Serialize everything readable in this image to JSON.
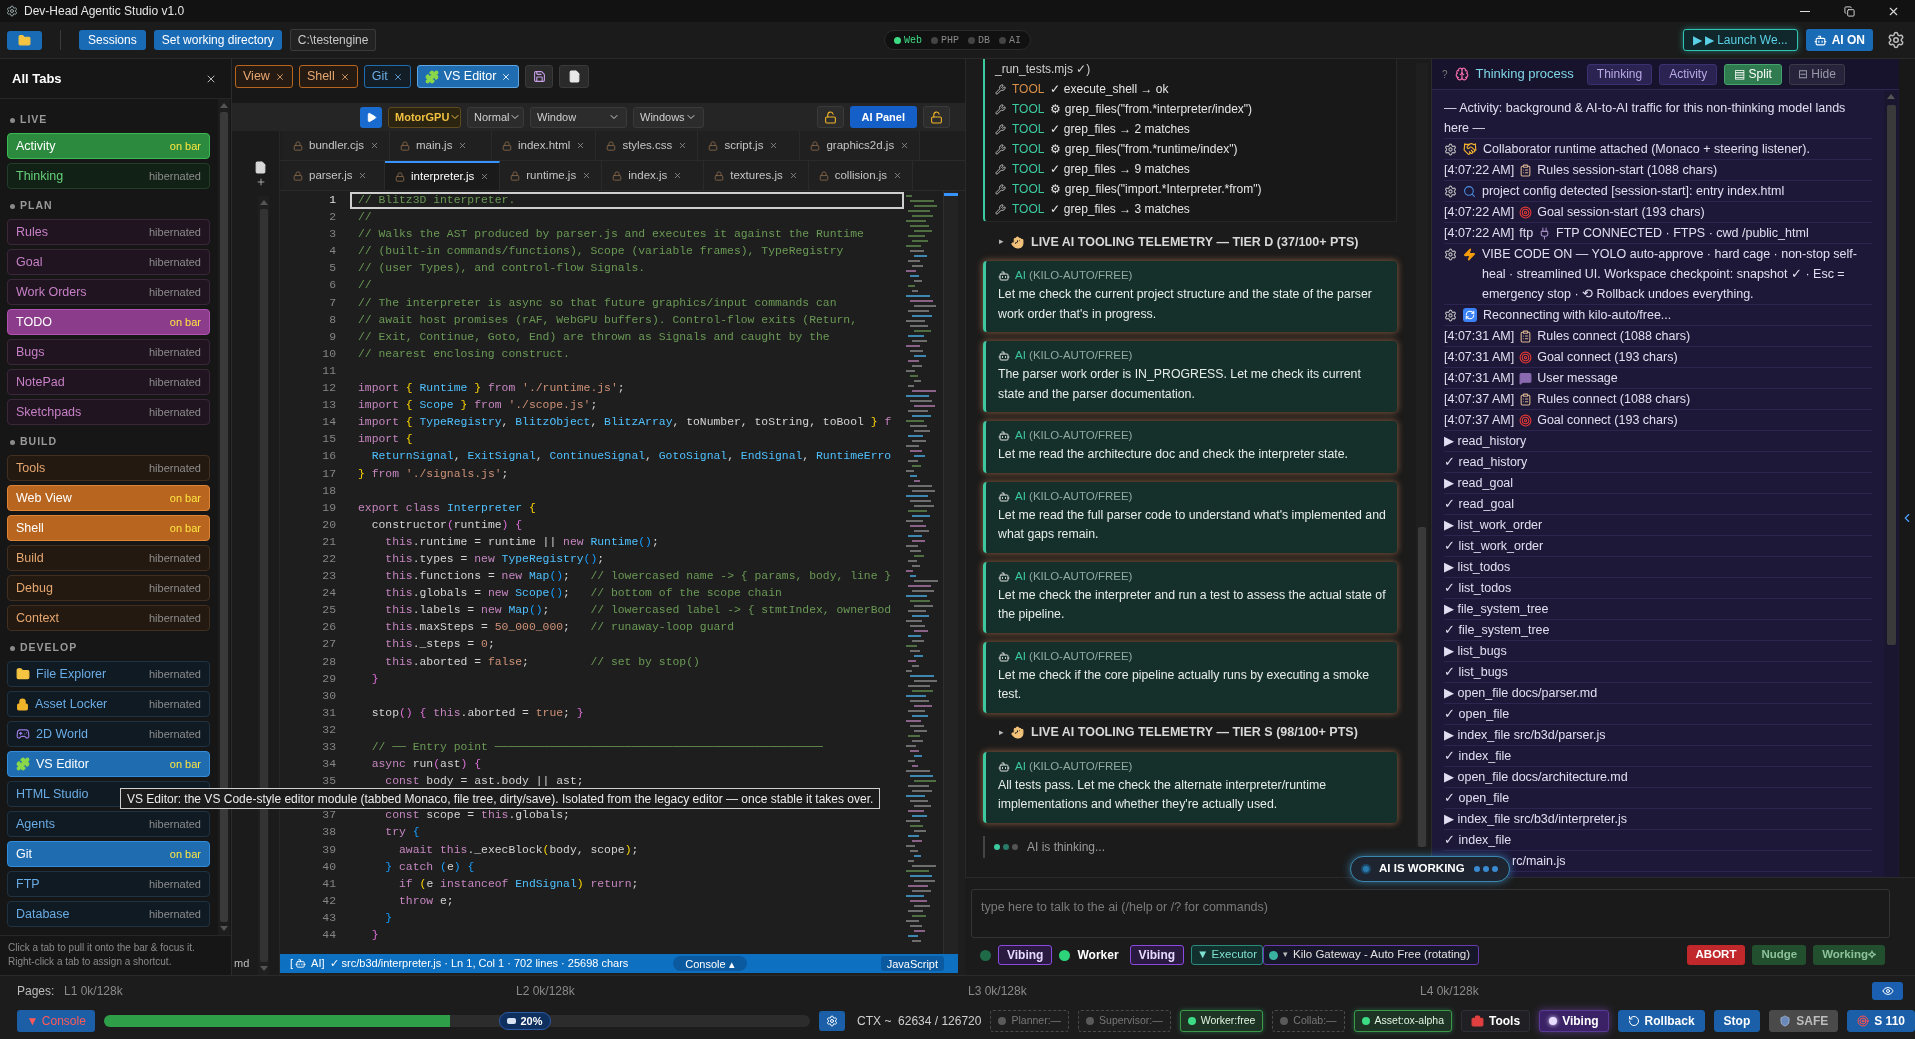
{
  "window": {
    "title": "Dev-Head Agentic Studio v1.0"
  },
  "toolbar": {
    "sessions": "Sessions",
    "set_directory": "Set working directory",
    "directory": "C:\\testengine",
    "services": [
      {
        "label": "Web",
        "on": true
      },
      {
        "label": "PHP",
        "on": false
      },
      {
        "label": "DB",
        "on": false
      },
      {
        "label": "AI",
        "on": false
      }
    ],
    "launch": "▶ ▶ Launch We...",
    "ai_toggle": "AI ON"
  },
  "all_tabs": {
    "title": "All Tabs",
    "groups": [
      {
        "name": "LIVE",
        "color": "#2b8a3e",
        "items": [
          {
            "label": "Activity",
            "status": "on bar",
            "on_bar": true,
            "kind": "plain"
          },
          {
            "label": "Thinking",
            "status": "hibernated",
            "on_bar": false,
            "kind": "plain"
          }
        ]
      },
      {
        "name": "PLAN",
        "color": "#8b3d8b",
        "items": [
          {
            "label": "Rules",
            "status": "hibernated",
            "on_bar": false,
            "kind": "plain"
          },
          {
            "label": "Goal",
            "status": "hibernated",
            "on_bar": false,
            "kind": "plain"
          },
          {
            "label": "Work Orders",
            "status": "hibernated",
            "on_bar": false,
            "kind": "plain"
          },
          {
            "label": "TODO",
            "status": "on bar",
            "on_bar": true,
            "kind": "plain"
          },
          {
            "label": "Bugs",
            "status": "hibernated",
            "on_bar": false,
            "kind": "plain"
          },
          {
            "label": "NotePad",
            "status": "hibernated",
            "on_bar": false,
            "kind": "plain"
          },
          {
            "label": "Sketchpads",
            "status": "hibernated",
            "on_bar": false,
            "kind": "plain"
          }
        ]
      },
      {
        "name": "BUILD",
        "color": "#b8661f",
        "items": [
          {
            "label": "Tools",
            "status": "hibernated",
            "on_bar": false,
            "kind": "plain"
          },
          {
            "label": "Web View",
            "status": "on bar",
            "on_bar": true,
            "kind": "plain"
          },
          {
            "label": "Shell",
            "status": "on bar",
            "on_bar": true,
            "kind": "plain"
          },
          {
            "label": "Build",
            "status": "hibernated",
            "on_bar": false,
            "kind": "plain"
          },
          {
            "label": "Debug",
            "status": "hibernated",
            "on_bar": false,
            "kind": "plain"
          },
          {
            "label": "Context",
            "status": "hibernated",
            "on_bar": false,
            "kind": "plain"
          }
        ]
      },
      {
        "name": "DEVELOP",
        "color": "#1f6db0",
        "items": [
          {
            "label": "File Explorer",
            "status": "hibernated",
            "on_bar": false,
            "kind": "explorer"
          },
          {
            "label": "Asset Locker",
            "status": "hibernated",
            "on_bar": false,
            "kind": "locker"
          },
          {
            "label": "2D World",
            "status": "hibernated",
            "on_bar": false,
            "kind": "world"
          },
          {
            "label": "VS Editor",
            "status": "on bar",
            "on_bar": true,
            "kind": "editor"
          },
          {
            "label": "HTML Studio",
            "on_bar": false,
            "kind": "plain"
          },
          {
            "label": "Agents",
            "status": "hibernated",
            "on_bar": false,
            "kind": "plain"
          },
          {
            "label": "Git",
            "status": "on bar",
            "on_bar": true,
            "kind": "plain"
          },
          {
            "label": "FTP",
            "status": "hibernated",
            "on_bar": false,
            "kind": "plain"
          },
          {
            "label": "Database",
            "status": "hibernated",
            "on_bar": false,
            "kind": "plain"
          }
        ]
      }
    ],
    "hint": [
      "Click a tab to pull it onto the bar & focus it.",
      "Right-click a tab to assign a shortcut."
    ]
  },
  "tooltip": "VS Editor: the VS Code-style editor module (tabbed Monaco, file tree, dirty/save). Isolated from the legacy editor — once stable it takes over.",
  "open_tabs": [
    {
      "label": "View",
      "color": "#b8661f",
      "selected": false,
      "kind": "plain"
    },
    {
      "label": "Shell",
      "color": "#b8661f",
      "selected": false,
      "kind": "plain"
    },
    {
      "label": "Git",
      "color": "#1f6db0",
      "selected": false,
      "kind": "plain"
    },
    {
      "label": "VS Editor",
      "color": "#1f6db0",
      "selected": true,
      "kind": "editor"
    }
  ],
  "editor": {
    "toolbar": {
      "target": "MotorGPU",
      "mode": "Normal",
      "display": "Window",
      "platform": "Windows",
      "ai_panel": "AI Panel"
    },
    "file_tabs": [
      [
        {
          "name": "bundler.cjs",
          "selected": false
        },
        {
          "name": "main.js",
          "selected": false
        },
        {
          "name": "index.html",
          "selected": false
        },
        {
          "name": "styles.css",
          "selected": false
        },
        {
          "name": "script.js",
          "selected": false
        },
        {
          "name": "graphics2d.js",
          "selected": false
        }
      ],
      [
        {
          "name": "parser.js",
          "selected": false
        },
        {
          "name": "interpreter.js",
          "selected": true
        },
        {
          "name": "runtime.js",
          "selected": false
        },
        {
          "name": "index.js",
          "selected": false
        },
        {
          "name": "textures.js",
          "selected": false
        },
        {
          "name": "collision.js",
          "selected": false
        }
      ]
    ],
    "explorer_tail": "md",
    "lines": [
      {
        "n": "1",
        "current": true,
        "code": [
          {
            "kind": "comment",
            "text": "// Blitz3D interpreter."
          }
        ]
      },
      {
        "n": "2",
        "code": [
          {
            "kind": "comment",
            "text": "//"
          }
        ]
      },
      {
        "n": "3",
        "code": [
          {
            "kind": "comment",
            "text": "// Walks the AST produced by parser.js and executes it against the Runtime"
          }
        ]
      },
      {
        "n": "4",
        "code": [
          {
            "kind": "comment",
            "text": "// (built-in commands/functions), Scope (variable frames), TypeRegistry"
          }
        ]
      },
      {
        "n": "5",
        "code": [
          {
            "kind": "comment",
            "text": "// (user Types), and control-flow Signals."
          }
        ]
      },
      {
        "n": "6",
        "code": [
          {
            "kind": "comment",
            "text": "//"
          }
        ]
      },
      {
        "n": "7",
        "code": [
          {
            "kind": "comment",
            "text": "// The interpreter is async so that future graphics/input commands can"
          }
        ]
      },
      {
        "n": "8",
        "code": [
          {
            "kind": "comment",
            "text": "// await host promises (rAF, WebGPU buffers). Control-flow exits (Return,"
          }
        ]
      },
      {
        "n": "9",
        "code": [
          {
            "kind": "comment",
            "text": "// Exit, Continue, Goto, End) are thrown as Signals and caught by the"
          }
        ]
      },
      {
        "n": "10",
        "code": [
          {
            "kind": "comment",
            "text": "// nearest enclosing construct."
          }
        ]
      },
      {
        "n": "11"
      },
      {
        "n": "12",
        "code": [
          {
            "kind": "keyword",
            "text": "import"
          },
          {
            "kind": "brace",
            "text": " { "
          },
          {
            "kind": "type",
            "text": "Runtime"
          },
          {
            "kind": "brace",
            "text": " }"
          },
          {
            "kind": "keyword",
            "text": " from "
          },
          {
            "kind": "literal",
            "text": "'./runtime.js'"
          },
          {
            "kind": "plain",
            "text": ";"
          }
        ]
      },
      {
        "n": "13",
        "code": [
          {
            "kind": "keyword",
            "text": "import"
          },
          {
            "kind": "brace",
            "text": " { "
          },
          {
            "kind": "type",
            "text": "Scope"
          },
          {
            "kind": "brace",
            "text": " }"
          },
          {
            "kind": "keyword",
            "text": " from "
          },
          {
            "kind": "literal",
            "text": "'./scope.js'"
          },
          {
            "kind": "plain",
            "text": ";"
          }
        ]
      },
      {
        "n": "14",
        "code": [
          {
            "kind": "keyword",
            "text": "import"
          },
          {
            "kind": "brace",
            "text": " { "
          },
          {
            "kind": "type",
            "text": "TypeRegistry"
          },
          {
            "kind": "plain",
            "text": ", "
          },
          {
            "kind": "type",
            "text": "BlitzObject"
          },
          {
            "kind": "plain",
            "text": ", "
          },
          {
            "kind": "type",
            "text": "BlitzArray"
          },
          {
            "kind": "plain",
            "text": ", toNumber, toString, toBool "
          },
          {
            "kind": "brace",
            "text": "}"
          },
          {
            "kind": "keyword",
            "text": " f"
          }
        ]
      },
      {
        "n": "15",
        "code": [
          {
            "kind": "keyword",
            "text": "import"
          },
          {
            "kind": "brace",
            "text": " {"
          }
        ]
      },
      {
        "n": "16",
        "code": [
          {
            "kind": "type",
            "text": "  ReturnSignal"
          },
          {
            "kind": "plain",
            "text": ", "
          },
          {
            "kind": "type",
            "text": "ExitSignal"
          },
          {
            "kind": "plain",
            "text": ", "
          },
          {
            "kind": "type",
            "text": "ContinueSignal"
          },
          {
            "kind": "plain",
            "text": ", "
          },
          {
            "kind": "type",
            "text": "GotoSignal"
          },
          {
            "kind": "plain",
            "text": ", "
          },
          {
            "kind": "type",
            "text": "EndSignal"
          },
          {
            "kind": "plain",
            "text": ", "
          },
          {
            "kind": "type",
            "text": "RuntimeErro"
          }
        ]
      },
      {
        "n": "17",
        "code": [
          {
            "kind": "brace",
            "text": "}"
          },
          {
            "kind": "keyword",
            "text": " from "
          },
          {
            "kind": "literal",
            "text": "'./signals.js'"
          },
          {
            "kind": "plain",
            "text": ";"
          }
        ]
      },
      {
        "n": "18"
      },
      {
        "n": "19",
        "code": [
          {
            "kind": "keyword",
            "text": "export class "
          },
          {
            "kind": "type",
            "text": "Interpreter"
          },
          {
            "kind": "brace",
            "text": " {"
          }
        ]
      },
      {
        "n": "20",
        "code": [
          {
            "kind": "plain",
            "text": "  constructor"
          },
          {
            "kind": "paren",
            "text": "("
          },
          {
            "kind": "plain",
            "text": "runtime"
          },
          {
            "kind": "paren",
            "text": ")"
          },
          {
            "kind": "paren",
            "text": " {"
          }
        ]
      },
      {
        "n": "21",
        "code": [
          {
            "kind": "keyword",
            "text": "    this"
          },
          {
            "kind": "plain",
            "text": ".runtime = runtime || "
          },
          {
            "kind": "keyword",
            "text": "new "
          },
          {
            "kind": "type",
            "text": "Runtime"
          },
          {
            "kind": "call",
            "text": "()"
          },
          {
            "kind": "plain",
            "text": ";"
          }
        ]
      },
      {
        "n": "22",
        "code": [
          {
            "kind": "keyword",
            "text": "    this"
          },
          {
            "kind": "plain",
            "text": ".types = "
          },
          {
            "kind": "keyword",
            "text": "new "
          },
          {
            "kind": "type",
            "text": "TypeRegistry"
          },
          {
            "kind": "call",
            "text": "()"
          },
          {
            "kind": "plain",
            "text": ";"
          }
        ]
      },
      {
        "n": "23",
        "code": [
          {
            "kind": "keyword",
            "text": "    this"
          },
          {
            "kind": "plain",
            "text": ".functions = "
          },
          {
            "kind": "keyword",
            "text": "new "
          },
          {
            "kind": "type",
            "text": "Map"
          },
          {
            "kind": "call",
            "text": "()"
          },
          {
            "kind": "plain",
            "text": ";   "
          },
          {
            "kind": "comment",
            "text": "// lowercased name -> { params, body, line }"
          }
        ]
      },
      {
        "n": "24",
        "code": [
          {
            "kind": "keyword",
            "text": "    this"
          },
          {
            "kind": "plain",
            "text": ".globals = "
          },
          {
            "kind": "keyword",
            "text": "new "
          },
          {
            "kind": "type",
            "text": "Scope"
          },
          {
            "kind": "call",
            "text": "()"
          },
          {
            "kind": "plain",
            "text": ";   "
          },
          {
            "kind": "comment",
            "text": "// bottom of the scope chain"
          }
        ]
      },
      {
        "n": "25",
        "code": [
          {
            "kind": "keyword",
            "text": "    this"
          },
          {
            "kind": "plain",
            "text": ".labels = "
          },
          {
            "kind": "keyword",
            "text": "new "
          },
          {
            "kind": "type",
            "text": "Map"
          },
          {
            "kind": "call",
            "text": "()"
          },
          {
            "kind": "plain",
            "text": ";      "
          },
          {
            "kind": "comment",
            "text": "// lowercased label -> { stmtIndex, ownerBod"
          }
        ]
      },
      {
        "n": "26",
        "code": [
          {
            "kind": "keyword",
            "text": "    this"
          },
          {
            "kind": "plain",
            "text": ".maxSteps = "
          },
          {
            "kind": "literal",
            "text": "50_000_000"
          },
          {
            "kind": "plain",
            "text": ";   "
          },
          {
            "kind": "comment",
            "text": "// runaway-loop guard"
          }
        ]
      },
      {
        "n": "27",
        "code": [
          {
            "kind": "keyword",
            "text": "    this"
          },
          {
            "kind": "plain",
            "text": "._steps = "
          },
          {
            "kind": "literal",
            "text": "0"
          },
          {
            "kind": "plain",
            "text": ";"
          }
        ]
      },
      {
        "n": "28",
        "code": [
          {
            "kind": "keyword",
            "text": "    this"
          },
          {
            "kind": "plain",
            "text": ".aborted = "
          },
          {
            "kind": "literal",
            "text": "false"
          },
          {
            "kind": "plain",
            "text": ";         "
          },
          {
            "kind": "comment",
            "text": "// set by stop()"
          }
        ]
      },
      {
        "n": "29",
        "code": [
          {
            "kind": "paren",
            "text": "  }"
          }
        ]
      },
      {
        "n": "30"
      },
      {
        "n": "31",
        "code": [
          {
            "kind": "plain",
            "text": "  stop"
          },
          {
            "kind": "paren",
            "text": "()"
          },
          {
            "kind": "paren",
            "text": " {"
          },
          {
            "kind": "keyword",
            "text": " this"
          },
          {
            "kind": "plain",
            "text": ".aborted = "
          },
          {
            "kind": "literal",
            "text": "true"
          },
          {
            "kind": "plain",
            "text": "; "
          },
          {
            "kind": "paren",
            "text": "}"
          }
        ]
      },
      {
        "n": "32"
      },
      {
        "n": "33",
        "code": [
          {
            "kind": "comment",
            "text": "  // ── Entry point ────────────────────────────────────────────────"
          }
        ]
      },
      {
        "n": "34",
        "code": [
          {
            "kind": "keyword",
            "text": "  async "
          },
          {
            "kind": "plain",
            "text": "run"
          },
          {
            "kind": "paren",
            "text": "("
          },
          {
            "kind": "plain",
            "text": "ast"
          },
          {
            "kind": "paren",
            "text": ")"
          },
          {
            "kind": "paren",
            "text": " {"
          }
        ]
      },
      {
        "n": "35",
        "code": [
          {
            "kind": "keyword",
            "text": "    const "
          },
          {
            "kind": "plain",
            "text": "body = ast.body || ast;"
          }
        ]
      },
      {
        "kind": "covered"
      },
      {
        "n": "37",
        "code": [
          {
            "kind": "keyword",
            "text": "    const "
          },
          {
            "kind": "plain",
            "text": "scope = "
          },
          {
            "kind": "keyword",
            "text": "this"
          },
          {
            "kind": "plain",
            "text": ".globals;"
          }
        ]
      },
      {
        "n": "38",
        "code": [
          {
            "kind": "keyword",
            "text": "    try "
          },
          {
            "kind": "call",
            "text": "{"
          }
        ]
      },
      {
        "n": "39",
        "code": [
          {
            "kind": "keyword",
            "text": "      await this"
          },
          {
            "kind": "plain",
            "text": "._execBlock"
          },
          {
            "kind": "brace",
            "text": "("
          },
          {
            "kind": "plain",
            "text": "body, scope"
          },
          {
            "kind": "brace",
            "text": ")"
          },
          {
            "kind": "plain",
            "text": ";"
          }
        ]
      },
      {
        "n": "40",
        "code": [
          {
            "kind": "call",
            "text": "    }"
          },
          {
            "kind": "keyword",
            "text": " catch "
          },
          {
            "kind": "call",
            "text": "("
          },
          {
            "kind": "plain",
            "text": "e"
          },
          {
            "kind": "call",
            "text": ")"
          },
          {
            "kind": "call",
            "text": " {"
          }
        ]
      },
      {
        "n": "41",
        "code": [
          {
            "kind": "keyword",
            "text": "      if "
          },
          {
            "kind": "brace",
            "text": "("
          },
          {
            "kind": "plain",
            "text": "e "
          },
          {
            "kind": "keyword",
            "text": "instanceof "
          },
          {
            "kind": "type",
            "text": "EndSignal"
          },
          {
            "kind": "brace",
            "text": ")"
          },
          {
            "kind": "keyword",
            "text": " return"
          },
          {
            "kind": "plain",
            "text": ";"
          }
        ]
      },
      {
        "n": "42",
        "code": [
          {
            "kind": "keyword",
            "text": "      throw "
          },
          {
            "kind": "plain",
            "text": "e;"
          }
        ]
      },
      {
        "n": "43",
        "code": [
          {
            "kind": "call",
            "text": "    }"
          }
        ]
      },
      {
        "n": "44",
        "code": [
          {
            "kind": "paren",
            "text": "  }"
          }
        ]
      }
    ],
    "status": {
      "ai_open": "[",
      "ai_tag": "AI]",
      "file": "✓ src/b3d/interpreter.js · Ln 1, Col 1 · 702 lines · 25698 chars",
      "console": "Console ▴",
      "language": "JavaScript"
    }
  },
  "chat": {
    "tool_log": {
      "tail": "_run_tests.mjs ✓)",
      "calls": [
        {
          "tag": "TOOL",
          "color": "#d9904a",
          "text": "✓ execute_shell → ok"
        },
        {
          "tag": "TOOL",
          "color": "#3cc9a0",
          "text": "⚙ grep_files(\"from.*interpreter/index\")"
        },
        {
          "tag": "TOOL",
          "color": "#3cc9a0",
          "text": "✓ grep_files → 2 matches"
        },
        {
          "tag": "TOOL",
          "color": "#3cc9a0",
          "text": "⚙ grep_files(\"from.*runtime/index\")"
        },
        {
          "tag": "TOOL",
          "color": "#3cc9a0",
          "text": "✓ grep_files → 9 matches"
        },
        {
          "tag": "TOOL",
          "color": "#3cc9a0",
          "text": "⚙ grep_files(\"import.*Interpreter.*from\")"
        },
        {
          "tag": "TOOL",
          "color": "#3cc9a0",
          "text": "✓ grep_files → 3 matches"
        }
      ]
    },
    "feed": [
      {
        "kind": "telemetry",
        "toggle": "▸",
        "text": "LIVE AI TOOLING TELEMETRY — TIER D (37/100+ PTS)"
      },
      {
        "kind": "message",
        "author": "AI",
        "model": "(KILO-AUTO/FREE)",
        "text": "Let me check the current project structure and the state of the parser work order that's in progress."
      },
      {
        "kind": "message",
        "author": "AI",
        "model": "(KILO-AUTO/FREE)",
        "text": "The parser work order is IN_PROGRESS. Let me check its current state and the parser documentation."
      },
      {
        "kind": "message",
        "author": "AI",
        "model": "(KILO-AUTO/FREE)",
        "text": "Let me read the architecture doc and check the interpreter state."
      },
      {
        "kind": "message",
        "author": "AI",
        "model": "(KILO-AUTO/FREE)",
        "text": "Let me read the full parser code to understand what's implemented and what gaps remain."
      },
      {
        "kind": "message",
        "author": "AI",
        "model": "(KILO-AUTO/FREE)",
        "text": "Let me check the interpreter and run a test to assess the actual state of the pipeline."
      },
      {
        "kind": "message",
        "author": "AI",
        "model": "(KILO-AUTO/FREE)",
        "text": "Let me check if the core pipeline actually runs by executing a smoke test."
      },
      {
        "kind": "telemetry",
        "toggle": "▸",
        "text": "LIVE AI TOOLING TELEMETRY — TIER S (98/100+ PTS)"
      },
      {
        "kind": "message",
        "author": "AI",
        "model": "(KILO-AUTO/FREE)",
        "text": "All tests pass. Let me check the alternate interpreter/runtime implementations and whether they're actually used."
      }
    ],
    "thinking": "AI is thinking...",
    "working": "AI IS WORKING",
    "input": {
      "placeholder": "type here to talk to the ai (/help or /? for commands)"
    },
    "agents": [
      {
        "color": "#1f6b47",
        "mode": "Vibing"
      },
      {
        "color": "#2ed47a",
        "role": "Worker",
        "mode": "Vibing"
      }
    ],
    "executor": "▼ Executor",
    "model": {
      "caret": "▾",
      "label": "Kilo Gateway - Auto Free (rotating)"
    },
    "actions": [
      {
        "label": "ABORT",
        "kind": "danger"
      },
      {
        "label": "Nudge",
        "kind": "muted"
      },
      {
        "label": "Working⟡",
        "kind": "muted"
      }
    ]
  },
  "thinking_panel": {
    "help": "?",
    "title": "Thinking process",
    "tabs": [
      {
        "label": "Thinking",
        "selected": false
      },
      {
        "label": "Activity",
        "selected": false
      },
      {
        "label": "▤ Split",
        "selected": true
      }
    ],
    "hide": "⊟ Hide",
    "lines": [
      {
        "kind": "note",
        "text": "— Activity: background & AI-to-AI traffic for this non-thinking model lands here —"
      },
      {
        "kind": "collab",
        "text": "Collaborator runtime attached (Monaco + steering listener)."
      },
      {
        "kind": "rules",
        "time": "[4:07:22 AM]",
        "text": "Rules session-start (1088 chars)"
      },
      {
        "kind": "config",
        "text": "project config detected [session-start]: entry index.html"
      },
      {
        "kind": "goal",
        "time": "[4:07:22 AM]",
        "text": "Goal session-start (193 chars)"
      },
      {
        "kind": "ftp",
        "time": "[4:07:22 AM]",
        "source": "ftp",
        "text": "FTP CONNECTED · FTPS · cwd /public_html"
      },
      {
        "kind": "vibe",
        "text": "VIBE CODE ON — YOLO auto-approve · hard cage · non-stop self-heal · streamlined UI. Workspace checkpoint: snapshot ✓ · Esc = emergency stop · ⟲ Rollback undoes everything."
      },
      {
        "kind": "reconnect",
        "text": "Reconnecting with kilo-auto/free..."
      },
      {
        "kind": "rules",
        "time": "[4:07:31 AM]",
        "text": "Rules connect (1088 chars)"
      },
      {
        "kind": "goal",
        "time": "[4:07:31 AM]",
        "text": "Goal connect (193 chars)"
      },
      {
        "kind": "user",
        "time": "[4:07:31 AM]",
        "text": "User message"
      },
      {
        "kind": "rules",
        "time": "[4:07:37 AM]",
        "text": "Rules connect (1088 chars)"
      },
      {
        "kind": "goal",
        "time": "[4:07:37 AM]",
        "text": "Goal connect (193 chars)"
      },
      {
        "kind": "step",
        "text": "▶ read_history"
      },
      {
        "kind": "step",
        "text": "✓ read_history"
      },
      {
        "kind": "step",
        "text": "▶ read_goal"
      },
      {
        "kind": "step",
        "text": "✓ read_goal"
      },
      {
        "kind": "step",
        "text": "▶ list_work_order"
      },
      {
        "kind": "step",
        "text": "✓ list_work_order"
      },
      {
        "kind": "step",
        "text": "▶ list_todos"
      },
      {
        "kind": "step",
        "text": "✓ list_todos"
      },
      {
        "kind": "step",
        "text": "▶ file_system_tree"
      },
      {
        "kind": "step",
        "text": "✓ file_system_tree"
      },
      {
        "kind": "step",
        "text": "▶ list_bugs"
      },
      {
        "kind": "step",
        "text": "✓ list_bugs"
      },
      {
        "kind": "step",
        "text": "▶ open_file docs/parser.md"
      },
      {
        "kind": "step",
        "text": "✓ open_file"
      },
      {
        "kind": "step",
        "text": "▶ index_file src/b3d/parser.js"
      },
      {
        "kind": "step",
        "text": "✓ index_file"
      },
      {
        "kind": "step",
        "text": "▶ open_file docs/architecture.md"
      },
      {
        "kind": "step",
        "text": "✓ open_file"
      },
      {
        "kind": "step",
        "text": "▶ index_file src/b3d/interpreter.js"
      },
      {
        "kind": "step",
        "text": "✓ index_file"
      },
      {
        "kind": "tail",
        "text": "rc/main.js"
      }
    ]
  },
  "footer": {
    "pages_label": "Pages:",
    "pages": [
      "L1 0k/128k",
      "L2 0k/128k",
      "L3 0k/128k",
      "L4 0k/128k"
    ],
    "console": "▼ Console",
    "context": {
      "level": 0.49,
      "reading": "20%"
    },
    "ctx": "CTX ~  62634 / 126720",
    "roles": [
      {
        "label": "Planner:—",
        "on": false
      },
      {
        "label": "Supervisor:—",
        "on": false
      },
      {
        "label": "Worker:free",
        "on": true
      },
      {
        "label": "Collab:—",
        "on": false
      },
      {
        "label": "Asset:ox-alpha",
        "on": true
      }
    ],
    "buttons": [
      {
        "label": "Tools",
        "kind": "tools"
      },
      {
        "label": "Vibing",
        "kind": "vibing"
      },
      {
        "label": "Rollback",
        "kind": "rollback"
      },
      {
        "label": "Stop",
        "kind": "stop"
      },
      {
        "label": "SAFE",
        "kind": "safe"
      },
      {
        "label": "S 110",
        "kind": "score"
      }
    ]
  }
}
